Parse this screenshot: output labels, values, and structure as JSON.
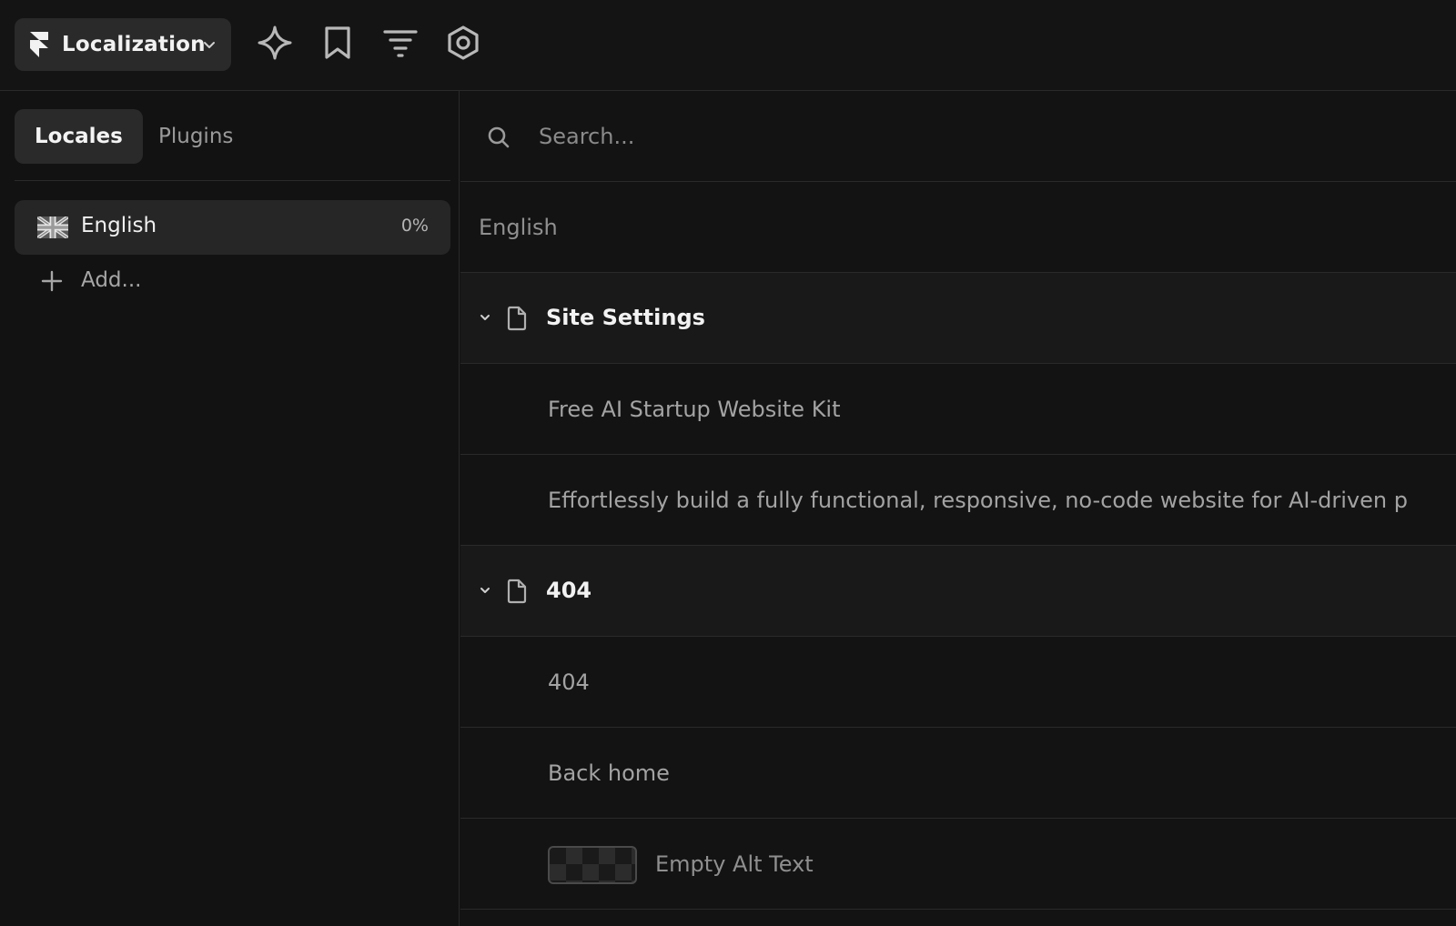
{
  "header": {
    "app_title": "Localization",
    "icons": [
      "sparkle-icon",
      "bookmark-icon",
      "filter-icon",
      "settings-icon"
    ]
  },
  "sidebar": {
    "tabs": [
      {
        "label": "Locales",
        "active": true
      },
      {
        "label": "Plugins",
        "active": false
      }
    ],
    "locales": [
      {
        "name": "English",
        "progress": "0%",
        "icon": "uk-flag-icon"
      }
    ],
    "add_label": "Add..."
  },
  "search": {
    "placeholder": "Search...",
    "value": ""
  },
  "content": {
    "locale_header": "English",
    "sections": [
      {
        "title": "Site Settings",
        "expanded": true,
        "items": [
          {
            "text": "Free AI Startup Website Kit"
          },
          {
            "text": "Effortlessly build a fully functional, responsive, no-code website for AI-driven p"
          }
        ]
      },
      {
        "title": "404",
        "expanded": true,
        "items": [
          {
            "text": "404"
          },
          {
            "text": "Back home"
          },
          {
            "text": "Empty Alt Text",
            "type": "image"
          }
        ]
      }
    ]
  },
  "colors": {
    "background": "#121212",
    "panel": "#2a2a2a",
    "section_row": "#191919",
    "border": "#2a2a2a",
    "text_primary": "#f2f2f2",
    "text_secondary": "#a3a3a3"
  }
}
